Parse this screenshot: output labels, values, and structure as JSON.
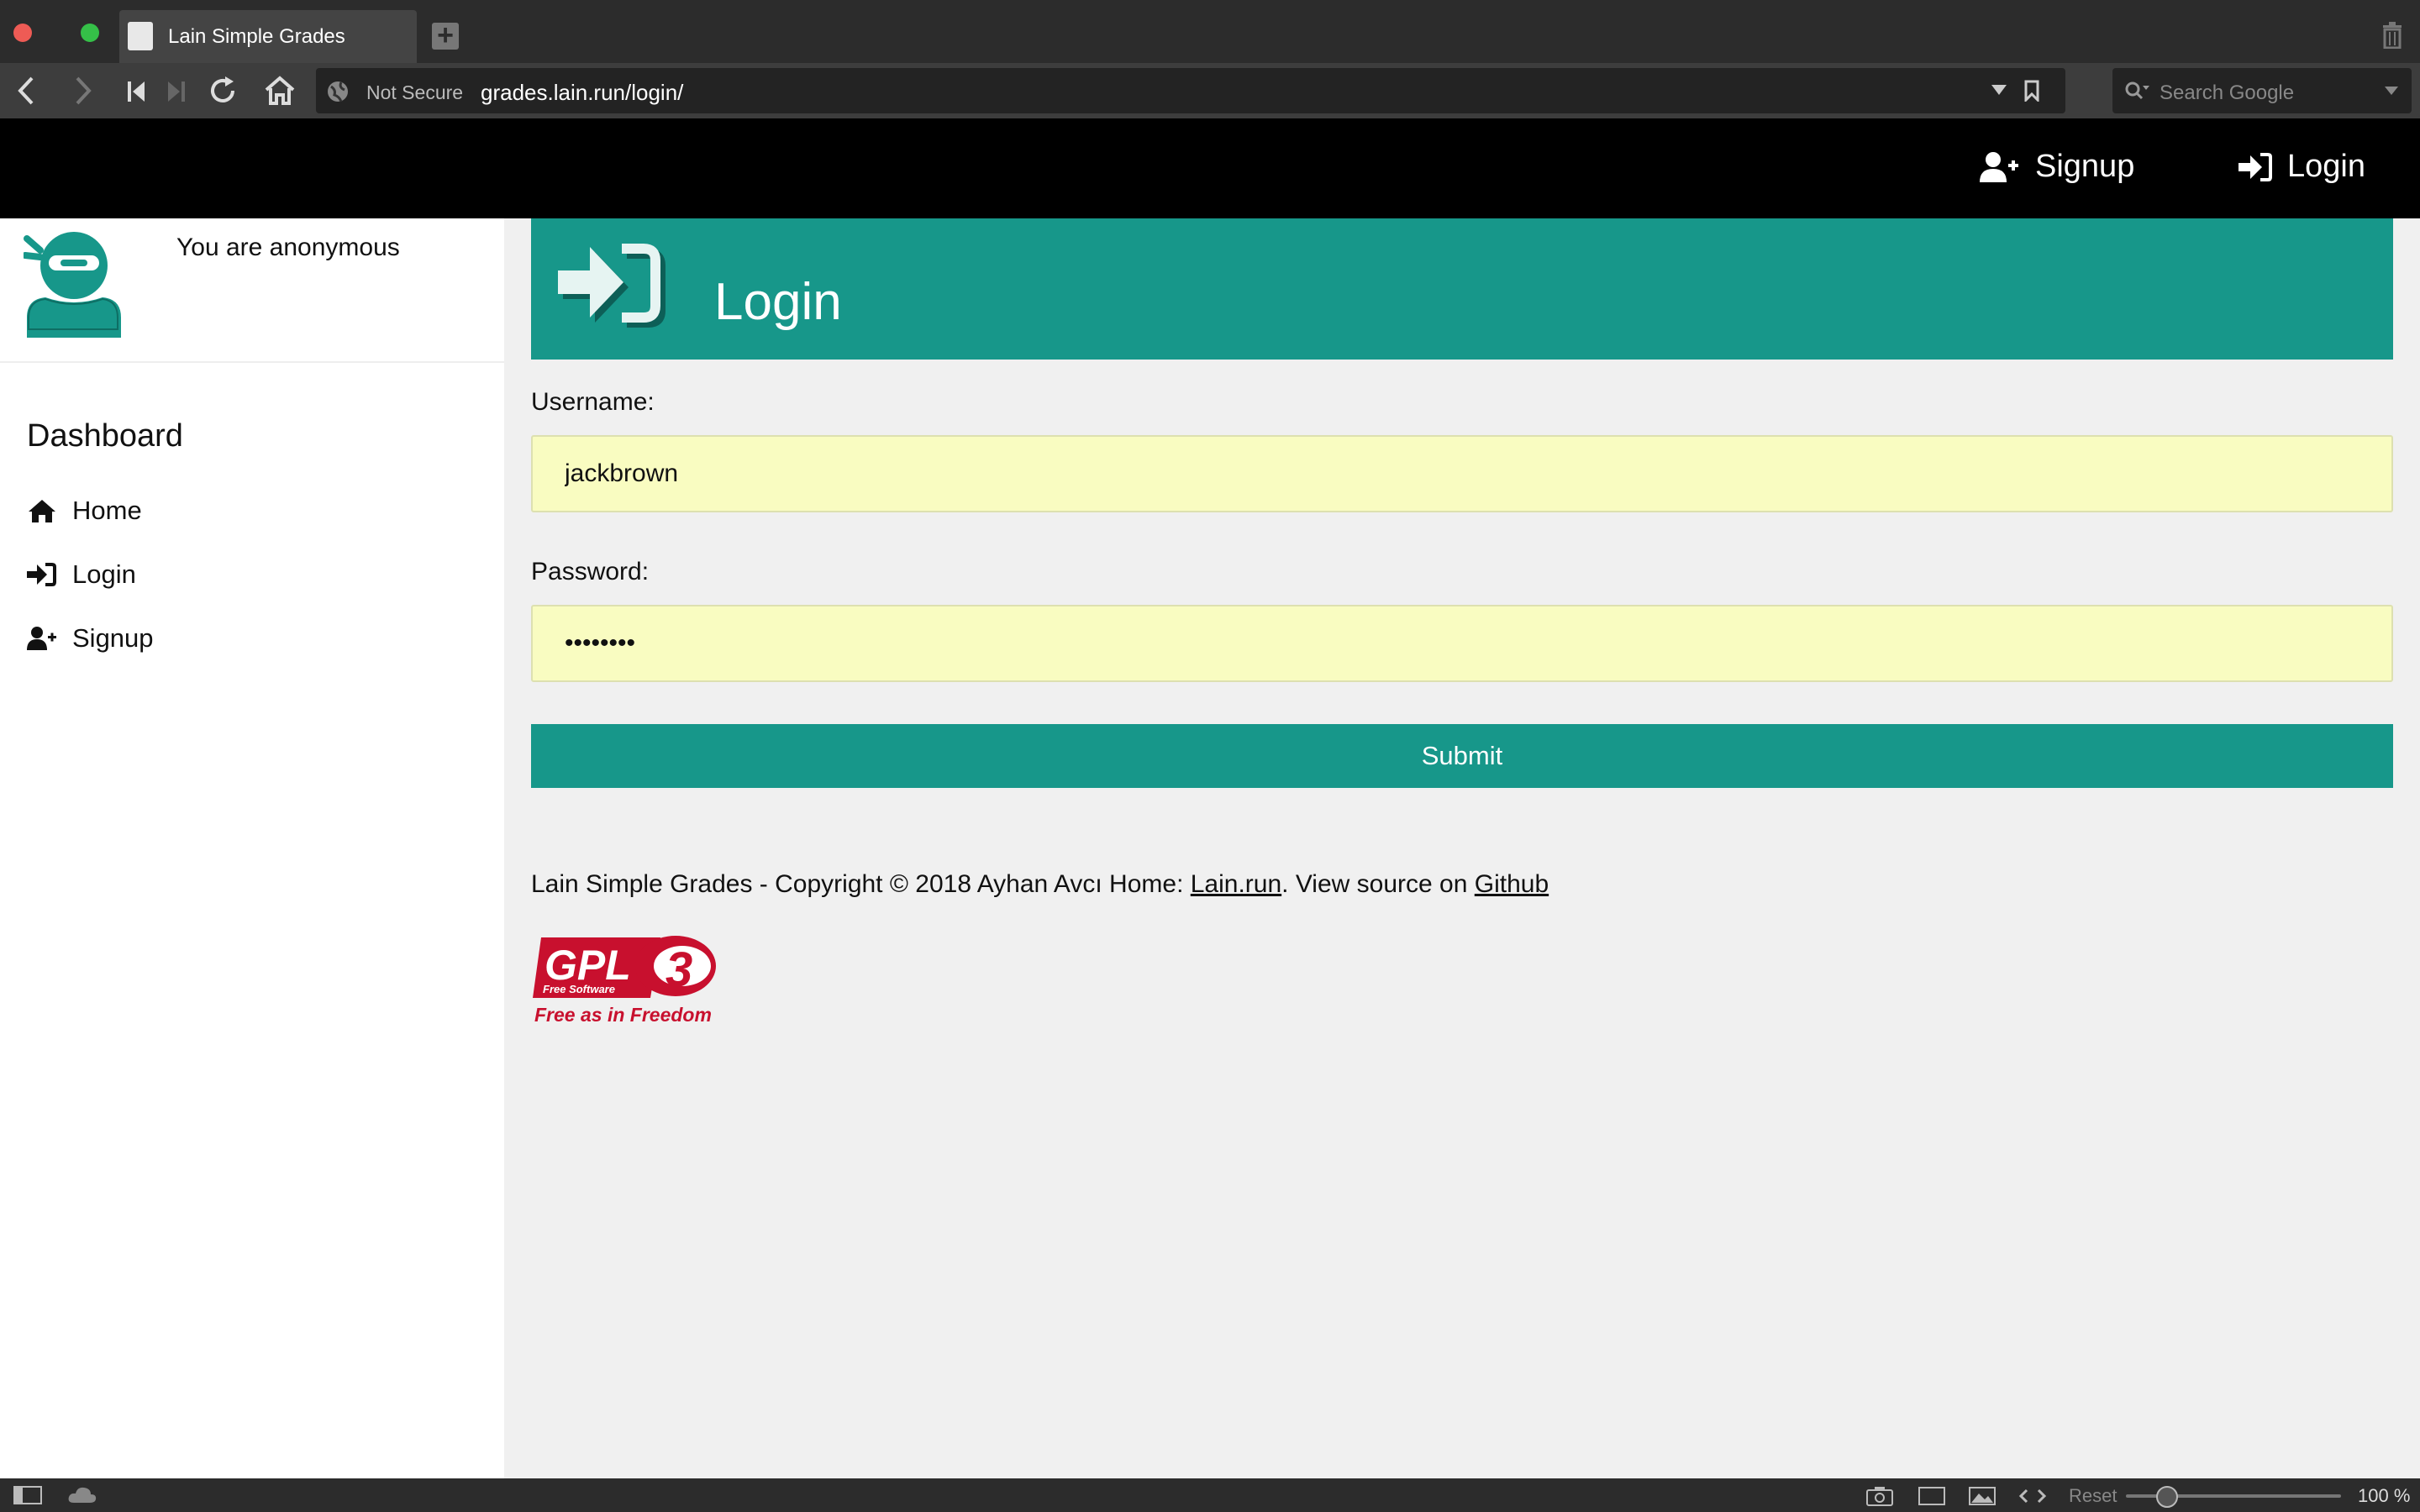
{
  "browser": {
    "tab_title": "Lain Simple Grades",
    "security_label": "Not Secure",
    "url": "grades.lain.run/login/",
    "search_placeholder": "Search Google",
    "reset_label": "Reset",
    "zoom_level": "100 %",
    "zoom_fraction": 0.1
  },
  "header": {
    "signup_label": "Signup",
    "login_label": "Login"
  },
  "sidebar": {
    "user_status": "You are anonymous",
    "section_title": "Dashboard",
    "items": [
      {
        "label": "Home",
        "icon": "home-icon"
      },
      {
        "label": "Login",
        "icon": "sign-in-icon"
      },
      {
        "label": "Signup",
        "icon": "user-plus-icon"
      }
    ]
  },
  "main": {
    "title": "Login",
    "username_label": "Username:",
    "username_value": "jackbrown",
    "password_label": "Password:",
    "password_value": "password",
    "submit_label": "Submit"
  },
  "footer": {
    "text_before": "Lain Simple Grades - Copyright © 2018 Ayhan Avcı Home: ",
    "home_link": "Lain.run",
    "text_middle": ". View source on ",
    "github_link": "Github",
    "badge_gpl": "GPL",
    "badge_free_software": "Free Software",
    "badge_motto": "Free as in Freedom"
  },
  "colors": {
    "accent": "#17978a",
    "input_bg": "#f9fcc1",
    "header_bg": "#000000",
    "gpl_red": "#c8102e"
  }
}
